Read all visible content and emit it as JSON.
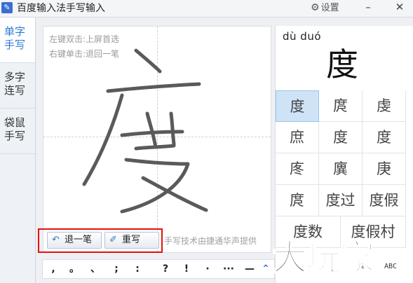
{
  "titlebar": {
    "icon": "app-logo",
    "title": "百度输入法手写输入",
    "settings_label": "设置",
    "minimize": "–",
    "close": "✕"
  },
  "sidebar": {
    "tabs": [
      {
        "line1": "单字",
        "line2": "手写",
        "active": true
      },
      {
        "line1": "多字",
        "line2": "连写",
        "active": false
      },
      {
        "line1": "袋鼠",
        "line2": "手写",
        "active": false
      }
    ]
  },
  "canvas": {
    "hint1": "左键双击:上屏首选",
    "hint2": "右键单击:退回一笔",
    "undo_label": "退一笔",
    "rewrite_label": "重写",
    "credit": "手写技术由捷通华声提供"
  },
  "punct": [
    ",",
    "。",
    "、",
    ";",
    ":",
    "?",
    "!",
    "·",
    "···",
    "—"
  ],
  "candidates": {
    "pinyin": "dù duó",
    "preview": "度",
    "items": [
      "度",
      "庹",
      "虔",
      "庶",
      "度",
      "度",
      "庝",
      "廙",
      "庚",
      "庹",
      "度过",
      "度假",
      "度数",
      "度假村"
    ],
    "selected_index": 0
  },
  "bottom_right": {
    "num_label": "123",
    "abc_label": "ABC"
  },
  "watermark": "大玩家",
  "colors": {
    "accent": "#2a78d6",
    "highlight_border": "#e3120b",
    "selected_bg": "#cfe3f7"
  }
}
